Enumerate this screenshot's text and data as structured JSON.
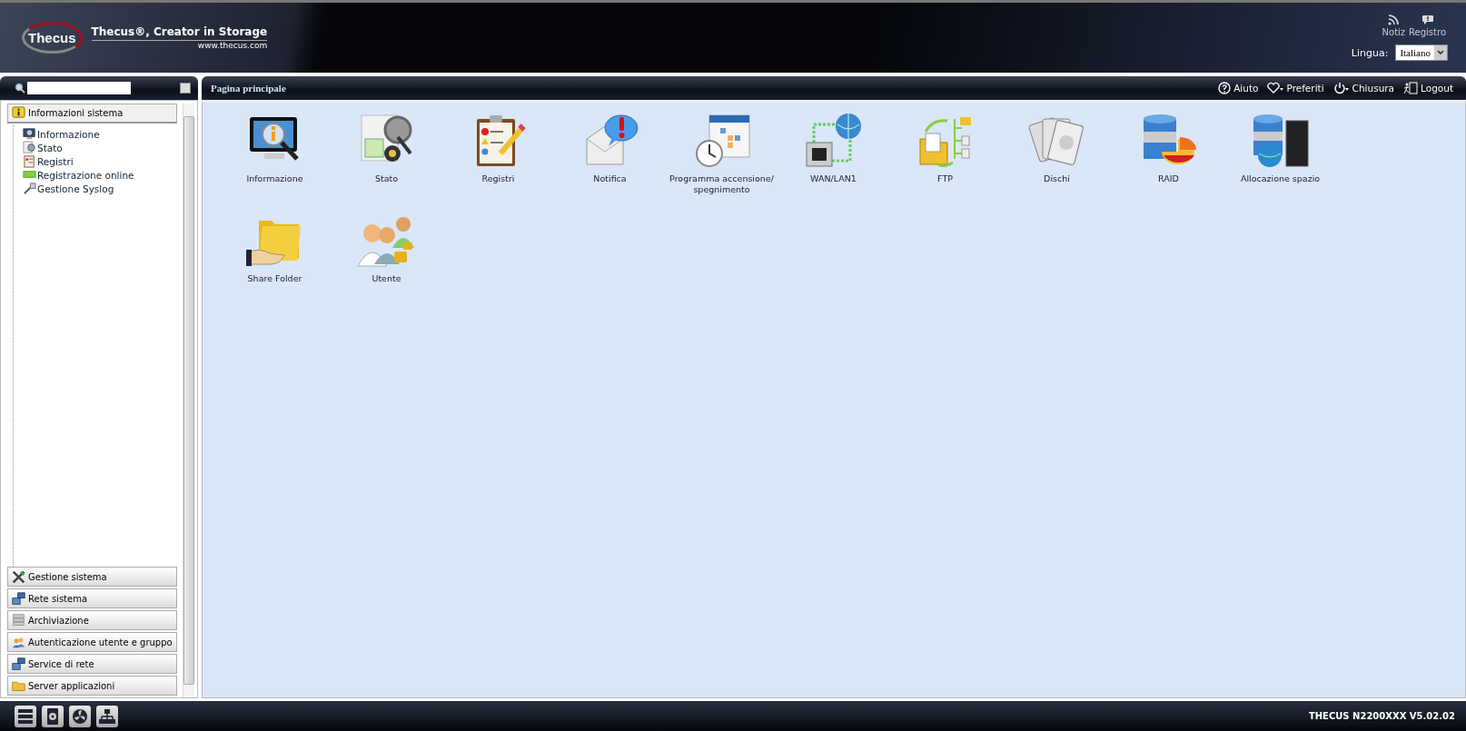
{
  "header": {
    "brand": "Thecus",
    "tagline": "Thecus®, Creator in Storage",
    "website": "www.thecus.com",
    "shortcuts": [
      {
        "kind": "rss",
        "label": "Notiz"
      },
      {
        "kind": "log",
        "label": "Registro"
      }
    ],
    "language": {
      "label": "Lingua:",
      "value": "Italiano"
    }
  },
  "sidebar": {
    "sections": [
      {
        "kind": "info",
        "label": "Informazioni sistema",
        "expanded": true,
        "children": [
          {
            "kind": "monitor",
            "label": "Informazione"
          },
          {
            "kind": "status",
            "label": "Stato"
          },
          {
            "kind": "log",
            "label": "Registri"
          },
          {
            "kind": "online",
            "label": "Registrazione online"
          },
          {
            "kind": "syslog",
            "label": "Gestione Syslog"
          }
        ]
      },
      {
        "kind": "tools",
        "label": "Gestione sistema",
        "expanded": false
      },
      {
        "kind": "network",
        "label": "Rete sistema",
        "expanded": false
      },
      {
        "kind": "storage",
        "label": "Archiviazione",
        "expanded": false
      },
      {
        "kind": "users",
        "label": "Autenticazione utente e gruppo",
        "expanded": false
      },
      {
        "kind": "network",
        "label": "Service di rete",
        "expanded": false
      },
      {
        "kind": "folder",
        "label": "Server applicazioni",
        "expanded": false
      }
    ]
  },
  "main": {
    "title": "Pagina principale",
    "actions": [
      {
        "kind": "help",
        "label": "Aiuto"
      },
      {
        "kind": "heart",
        "label": "Preferiti"
      },
      {
        "kind": "power",
        "label": "Chiusura"
      },
      {
        "kind": "exit",
        "label": "Logout"
      }
    ],
    "tiles": [
      {
        "kind": "info",
        "label": "Informazione"
      },
      {
        "kind": "status",
        "label": "Stato"
      },
      {
        "kind": "log",
        "label": "Registri"
      },
      {
        "kind": "notify",
        "label": "Notifica"
      },
      {
        "kind": "schedule",
        "label": "Programma accensione/ spegnimento"
      },
      {
        "kind": "network",
        "label": "WAN/LAN1"
      },
      {
        "kind": "ftp",
        "label": "FTP"
      },
      {
        "kind": "disks",
        "label": "Dischi"
      },
      {
        "kind": "raid",
        "label": "RAID"
      },
      {
        "kind": "space",
        "label": "Allocazione spazio"
      },
      {
        "kind": "share",
        "label": "Share Folder"
      },
      {
        "kind": "users",
        "label": "Utente"
      }
    ]
  },
  "footer": {
    "taskbar": [
      {
        "kind": "server"
      },
      {
        "kind": "disk"
      },
      {
        "kind": "fan"
      },
      {
        "kind": "network"
      }
    ],
    "version": "THECUS N2200XXX V5.02.02"
  }
}
